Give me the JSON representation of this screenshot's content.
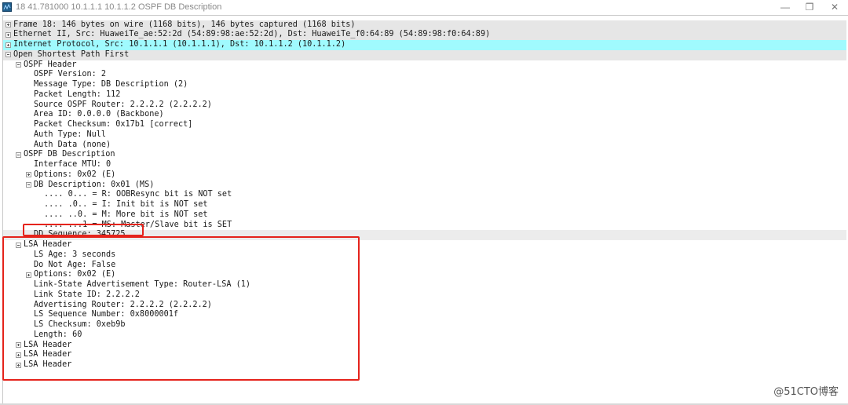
{
  "window": {
    "title": "18 41.781000 10.1.1.1 10.1.1.2 OSPF DB Description",
    "icon": "wireshark-icon",
    "minimize_label": "—",
    "restore_label": "❐",
    "close_label": "✕"
  },
  "tree": {
    "rows": [
      {
        "text": "Frame 18: 146 bytes on wire (1168 bits), 146 bytes captured (1168 bits)",
        "level": 0,
        "toggle": "plus",
        "bg": "gray"
      },
      {
        "text": "Ethernet II, Src: HuaweiTe_ae:52:2d (54:89:98:ae:52:2d), Dst: HuaweiTe_f0:64:89 (54:89:98:f0:64:89)",
        "level": 0,
        "toggle": "plus",
        "bg": "gray"
      },
      {
        "text": "Internet Protocol, Src: 10.1.1.1 (10.1.1.1), Dst: 10.1.1.2 (10.1.1.2)",
        "level": 0,
        "toggle": "plus",
        "bg": "cyan"
      },
      {
        "text": "Open Shortest Path First",
        "level": 0,
        "toggle": "minus",
        "bg": "gray"
      },
      {
        "text": "OSPF Header",
        "level": 1,
        "toggle": "minus",
        "bg": ""
      },
      {
        "text": "OSPF Version: 2",
        "level": 2,
        "toggle": "",
        "bg": ""
      },
      {
        "text": "Message Type: DB Description (2)",
        "level": 2,
        "toggle": "",
        "bg": ""
      },
      {
        "text": "Packet Length: 112",
        "level": 2,
        "toggle": "",
        "bg": ""
      },
      {
        "text": "Source OSPF Router: 2.2.2.2 (2.2.2.2)",
        "level": 2,
        "toggle": "",
        "bg": ""
      },
      {
        "text": "Area ID: 0.0.0.0 (Backbone)",
        "level": 2,
        "toggle": "",
        "bg": ""
      },
      {
        "text": "Packet Checksum: 0x17b1 [correct]",
        "level": 2,
        "toggle": "",
        "bg": ""
      },
      {
        "text": "Auth Type: Null",
        "level": 2,
        "toggle": "",
        "bg": ""
      },
      {
        "text": "Auth Data (none)",
        "level": 2,
        "toggle": "",
        "bg": ""
      },
      {
        "text": "OSPF DB Description",
        "level": 1,
        "toggle": "minus",
        "bg": ""
      },
      {
        "text": "Interface MTU: 0",
        "level": 2,
        "toggle": "",
        "bg": ""
      },
      {
        "text": "Options: 0x02 (E)",
        "level": 2,
        "toggle": "plus",
        "bg": ""
      },
      {
        "text": "DB Description: 0x01 (MS)",
        "level": 2,
        "toggle": "minus",
        "bg": ""
      },
      {
        "text": ".... 0... = R: OOBResync bit is NOT set",
        "level": 3,
        "toggle": "",
        "bg": ""
      },
      {
        "text": ".... .0.. = I: Init bit is NOT set",
        "level": 3,
        "toggle": "",
        "bg": ""
      },
      {
        "text": ".... ..0. = M: More bit is NOT set",
        "level": 3,
        "toggle": "",
        "bg": ""
      },
      {
        "text": ".... ...1 = MS: Master/Slave bit is SET",
        "level": 3,
        "toggle": "",
        "bg": ""
      },
      {
        "text": "DD Sequence: 345725",
        "level": 2,
        "toggle": "",
        "bg": "sel"
      },
      {
        "text": "LSA Header",
        "level": 1,
        "toggle": "minus",
        "bg": ""
      },
      {
        "text": "LS Age: 3 seconds",
        "level": 2,
        "toggle": "",
        "bg": ""
      },
      {
        "text": "Do Not Age: False",
        "level": 2,
        "toggle": "",
        "bg": ""
      },
      {
        "text": "Options: 0x02 (E)",
        "level": 2,
        "toggle": "plus",
        "bg": ""
      },
      {
        "text": "Link-State Advertisement Type: Router-LSA (1)",
        "level": 2,
        "toggle": "",
        "bg": ""
      },
      {
        "text": "Link State ID: 2.2.2.2",
        "level": 2,
        "toggle": "",
        "bg": ""
      },
      {
        "text": "Advertising Router: 2.2.2.2 (2.2.2.2)",
        "level": 2,
        "toggle": "",
        "bg": ""
      },
      {
        "text": "LS Sequence Number: 0x8000001f",
        "level": 2,
        "toggle": "",
        "bg": ""
      },
      {
        "text": "LS Checksum: 0xeb9b",
        "level": 2,
        "toggle": "",
        "bg": ""
      },
      {
        "text": "Length: 60",
        "level": 2,
        "toggle": "",
        "bg": ""
      },
      {
        "text": "LSA Header",
        "level": 1,
        "toggle": "plus",
        "bg": ""
      },
      {
        "text": "LSA Header",
        "level": 1,
        "toggle": "plus",
        "bg": ""
      },
      {
        "text": "LSA Header",
        "level": 1,
        "toggle": "plus",
        "bg": ""
      }
    ]
  },
  "annotations": {
    "highlight_color": "#e5231b",
    "dd_sequence_box": "DD Sequence",
    "lsa_header_box": "LSA Header"
  },
  "watermark": "@51CTO博客"
}
